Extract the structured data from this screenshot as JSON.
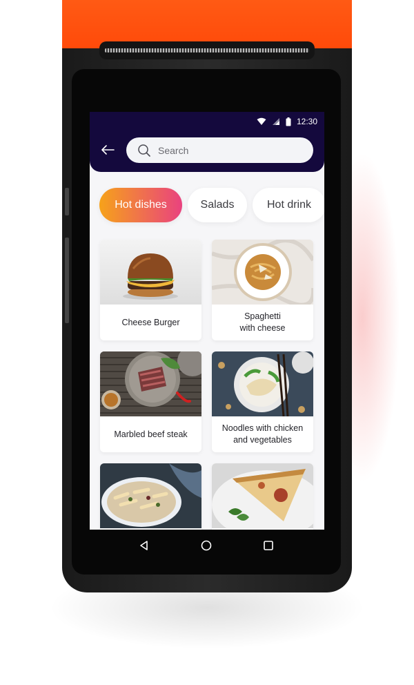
{
  "status_bar": {
    "time": "12:30"
  },
  "search": {
    "placeholder": "Search"
  },
  "tabs": [
    {
      "label": "Hot dishes",
      "active": true
    },
    {
      "label": "Salads",
      "active": false
    },
    {
      "label": "Hot drink",
      "active": false
    }
  ],
  "dishes": [
    {
      "name": "Cheese Burger"
    },
    {
      "name": "Spaghetti\nwith cheese"
    },
    {
      "name": "Marbled beef steak"
    },
    {
      "name": "Noodles with chicken\nand vegetables"
    },
    {
      "name": ""
    },
    {
      "name": ""
    }
  ],
  "colors": {
    "device_accent": "#ff5a14",
    "header_bg": "#14093d",
    "tab_gradient_start": "#f6a21a",
    "tab_gradient_end": "#e9427f"
  },
  "icons": {
    "back": "arrow-left-icon",
    "search": "search-icon",
    "wifi": "wifi-icon",
    "signal": "signal-icon",
    "battery": "battery-icon",
    "nav_back": "triangle-back-icon",
    "nav_home": "circle-home-icon",
    "nav_recents": "square-recents-icon"
  }
}
